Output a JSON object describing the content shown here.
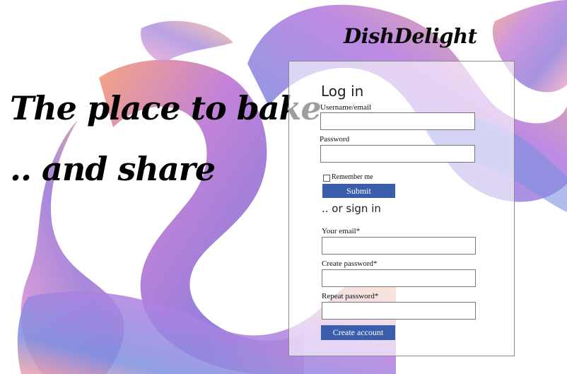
{
  "brand": {
    "name": "DishDelight"
  },
  "hero": {
    "line1": "The place to bake",
    "line2": ".. and share"
  },
  "login": {
    "heading": "Log in",
    "username_label": "Username/email",
    "username_value": "",
    "password_label": "Password",
    "password_value": "",
    "remember_label": "Remember me",
    "remember_checked": false,
    "submit_label": "Submit"
  },
  "signup": {
    "heading": ".. or sign in",
    "email_label": "Your email*",
    "email_value": "",
    "create_password_label": "Create password*",
    "create_password_value": "",
    "repeat_password_label": "Repeat password*",
    "repeat_password_value": "",
    "create_account_label": "Create account"
  },
  "colors": {
    "button": "#3b5eac",
    "panel_border": "#8a8a8a"
  }
}
